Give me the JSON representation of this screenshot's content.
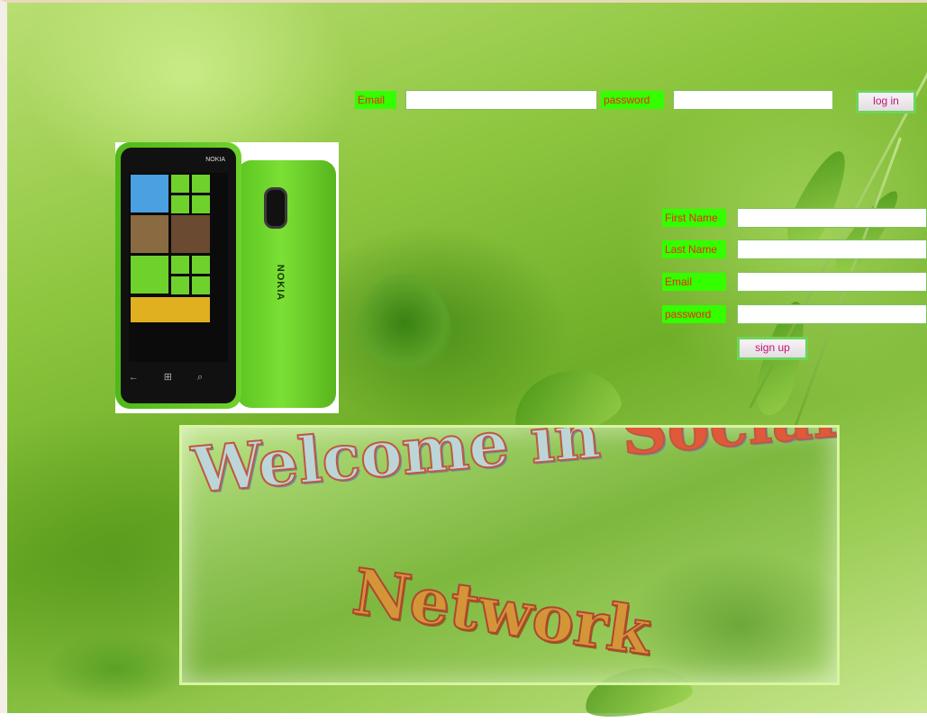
{
  "login": {
    "email_label": "Email",
    "email_value": "",
    "password_label": "password",
    "password_value": "",
    "button_label": "log in"
  },
  "signup": {
    "first_name_label": "First Name",
    "last_name_label": "Last Name",
    "email_label": "Email",
    "password_label": "password",
    "first_name_value": "",
    "last_name_value": "",
    "email_value": "",
    "password_value": "",
    "button_label": "sign up"
  },
  "phone": {
    "brand_front": "NOKIA",
    "brand_back": "NOKIA"
  },
  "banner": {
    "line1_part1": "Welcome in ",
    "line1_part2": "Social",
    "line2": "Network"
  },
  "colors": {
    "label_bg": "#33ff00",
    "label_text": "#ff1a1a",
    "button_border": "#6fd35a",
    "button_text": "#c0147a"
  }
}
